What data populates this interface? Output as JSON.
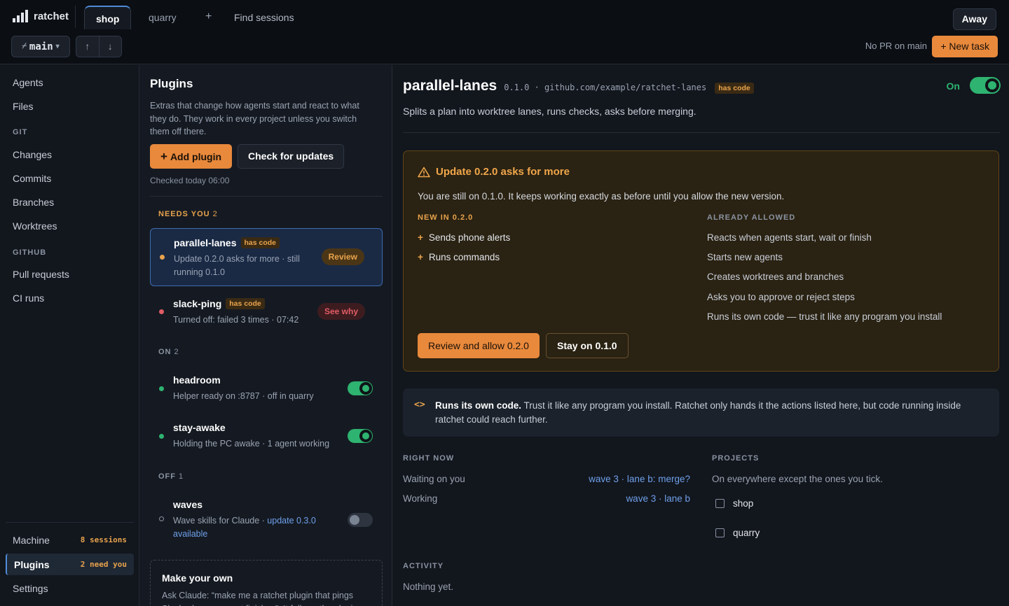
{
  "app": {
    "name": "ratchet"
  },
  "tabs": [
    {
      "label": "shop"
    },
    {
      "label": "quarry"
    }
  ],
  "tab_add_label": "+",
  "find_sessions": "Find sessions",
  "away_label": "Away",
  "branch": {
    "label": "main",
    "prefix": "⌿",
    "caret": "▾"
  },
  "nav_arrows": {
    "up": "↑",
    "down": "↓"
  },
  "pr_status": "No PR on main",
  "new_task_label": "+ New task",
  "sidebar": {
    "top_items": [
      {
        "label": "Agents"
      },
      {
        "label": "Files"
      }
    ],
    "git_heading": "GIT",
    "git_items": [
      {
        "label": "Changes"
      },
      {
        "label": "Commits"
      },
      {
        "label": "Branches"
      },
      {
        "label": "Worktrees"
      }
    ],
    "github_heading": "GITHUB",
    "github_items": [
      {
        "label": "Pull requests"
      },
      {
        "label": "CI runs"
      }
    ],
    "bottom": [
      {
        "label": "Machine",
        "count": "8 sessions"
      },
      {
        "label": "Plugins",
        "count": "2 need you"
      },
      {
        "label": "Settings",
        "count": ""
      }
    ]
  },
  "plugins": {
    "title": "Plugins",
    "description": "Extras that change how agents start and react to what they do. They work in every project unless you switch them off there.",
    "add_label": "Add plugin",
    "add_icon": "+",
    "check_label": "Check for updates",
    "checked_text": "Checked today 06:00",
    "needs_heading": "NEEDS YOU",
    "needs_count": "2",
    "on_heading": "ON",
    "on_count": "2",
    "off_heading": "OFF",
    "off_count": "1",
    "items": [
      {
        "name": "parallel-lanes",
        "badge": "has code",
        "sub": "Update 0.2.0 asks for more · still running 0.1.0",
        "action": "Review",
        "dot_color": "#e8a34c"
      },
      {
        "name": "slack-ping",
        "badge": "has code",
        "sub": "Turned off: failed 3 times · 07:42",
        "action": "See why",
        "dot_color": "#e05c64"
      },
      {
        "name": "headroom",
        "sub": "Helper ready on :8787 · off in quarry",
        "enabled": true,
        "dot_color": "#2eb370"
      },
      {
        "name": "stay-awake",
        "sub": "Holding the PC awake · 1 agent working",
        "enabled": true,
        "dot_color": "#2eb370"
      },
      {
        "name": "waves",
        "sub": "Wave skills for Claude · ",
        "sub_link": "update 0.3.0 available",
        "enabled": false,
        "dot_color": "#8a93a2"
      }
    ],
    "make_own": {
      "title": "Make your own",
      "text": "Ask Claude: “make me a ratchet plugin that pings Slack when an agent finishes”. It follows the plugin"
    }
  },
  "detail": {
    "name": "parallel-lanes",
    "version_line": "0.1.0 · github.com/example/ratchet-lanes",
    "badge": "has code",
    "on_label": "On",
    "enabled": true,
    "description": "Splits a plan into worktree lanes, runs checks, asks before merging.",
    "update": {
      "title": "Update 0.2.0 asks for more",
      "text": "You are still on 0.1.0. It keeps working exactly as before until you allow the new version.",
      "new_heading": "NEW IN 0.2.0",
      "new_items": [
        "Sends phone alerts",
        "Runs commands"
      ],
      "allowed_heading": "ALREADY ALLOWED",
      "allowed_items": [
        "Reacts when agents start, wait or finish",
        "Starts new agents",
        "Creates worktrees and branches",
        "Asks you to approve or reject steps",
        "Runs its own code — trust it like any program you install"
      ],
      "review_label": "Review and allow 0.2.0",
      "stay_label": "Stay on 0.1.0"
    },
    "runs_code": {
      "icon": "<>",
      "bold": "Runs its own code.",
      "text": " Trust it like any program you install. Ratchet only hands it the actions listed here, but code running inside ratchet could reach further."
    },
    "right_now": {
      "heading": "RIGHT NOW",
      "rows": [
        {
          "label": "Waiting on you",
          "value": "wave 3 · lane b: merge?"
        },
        {
          "label": "Working",
          "value": "wave 3 · lane b"
        }
      ]
    },
    "projects": {
      "heading": "PROJECTS",
      "text": "On everywhere except the ones you tick.",
      "items": [
        {
          "label": "shop",
          "checked": false
        },
        {
          "label": "quarry",
          "checked": false
        }
      ]
    },
    "activity": {
      "heading": "ACTIVITY",
      "text": "Nothing yet."
    }
  },
  "colors": {
    "accent": "#e8893c",
    "on": "#2eb370",
    "link": "#6ea0ea",
    "warn": "#e8a34c"
  }
}
